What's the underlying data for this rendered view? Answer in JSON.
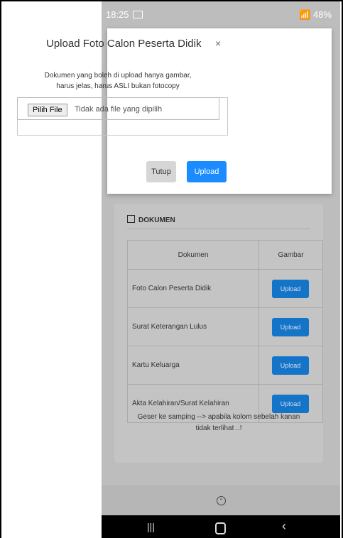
{
  "status_bar": {
    "time": "18:25",
    "battery": "48%"
  },
  "modal": {
    "title": "Upload Foto Calon Peserta Didik",
    "close_symbol": "×",
    "description_line1": "Dokumen yang boleh di upload hanya gambar,",
    "description_line2": "harus jelas, harus ASLI bukan fotocopy",
    "choose_file_label": "Pilih File",
    "file_status": "Tidak ada file yang dipilih",
    "cancel_label": "Tutup",
    "submit_label": "Upload"
  },
  "documents": {
    "section_title": "DOKUMEN",
    "headers": [
      "Dokumen",
      "Gambar"
    ],
    "rows": [
      {
        "name": "Foto Calon Peserta Didik",
        "action": "Upload"
      },
      {
        "name": "Surat Keterangan Lulus",
        "action": "Upload"
      },
      {
        "name": "Kartu Keluarga",
        "action": "Upload"
      },
      {
        "name": "Akta Kelahiran/Surat Kelahiran",
        "action": "Upload"
      }
    ],
    "hint_line1": "Geser ke samping --> apabila kolom sebelah kanan",
    "hint_line2": "tidak terlihat ..!"
  },
  "icons": {
    "scroll_top": "chevron-up-circle-icon",
    "nav_recent": "recent-apps-icon",
    "nav_home": "home-icon",
    "nav_back": "back-icon"
  },
  "colors": {
    "primary": "#1a8cff",
    "upload_dim": "#1474c8",
    "navbar": "#000000"
  }
}
